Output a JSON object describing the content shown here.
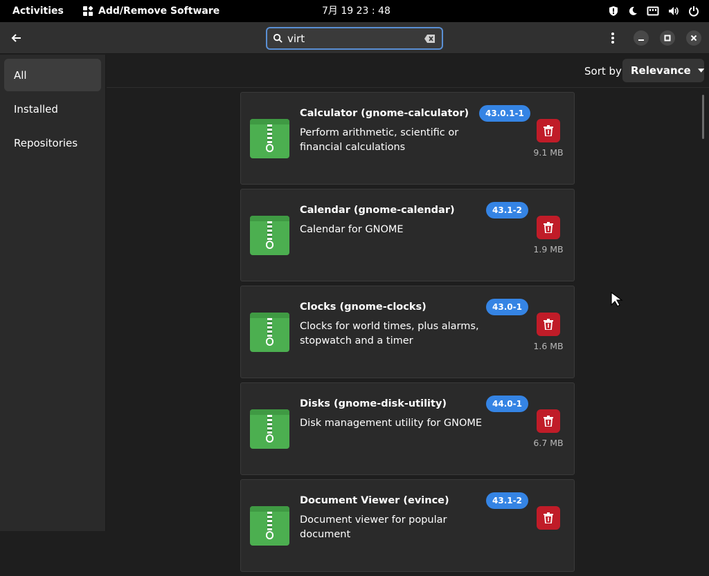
{
  "topbar": {
    "activities": "Activities",
    "app_name": "Add/Remove Software",
    "clock": "7月 19 23 : 48"
  },
  "search": {
    "value": "virt"
  },
  "sidebar": {
    "items": [
      {
        "label": "All"
      },
      {
        "label": "Installed"
      },
      {
        "label": "Repositories"
      }
    ]
  },
  "sort": {
    "label": "Sort by",
    "value": "Relevance"
  },
  "packages": [
    {
      "name": "Calculator (gnome-calculator)",
      "version": "43.0.1-1",
      "description": "Perform arithmetic, scientific or financial calculations",
      "size": "9.1 MB"
    },
    {
      "name": "Calendar (gnome-calendar)",
      "version": "43.1-2",
      "description": "Calendar for GNOME",
      "size": "1.9 MB"
    },
    {
      "name": "Clocks (gnome-clocks)",
      "version": "43.0-1",
      "description": "Clocks for world times, plus alarms, stopwatch and a timer",
      "size": "1.6 MB"
    },
    {
      "name": "Disks (gnome-disk-utility)",
      "version": "44.0-1",
      "description": "Disk management utility for GNOME",
      "size": "6.7 MB"
    },
    {
      "name": "Document Viewer (evince)",
      "version": "43.1-2",
      "description": "Document viewer for popular document",
      "size": ""
    }
  ],
  "colors": {
    "accent": "#3584e4",
    "danger": "#c01c28",
    "app_icon": "#4caf50"
  }
}
